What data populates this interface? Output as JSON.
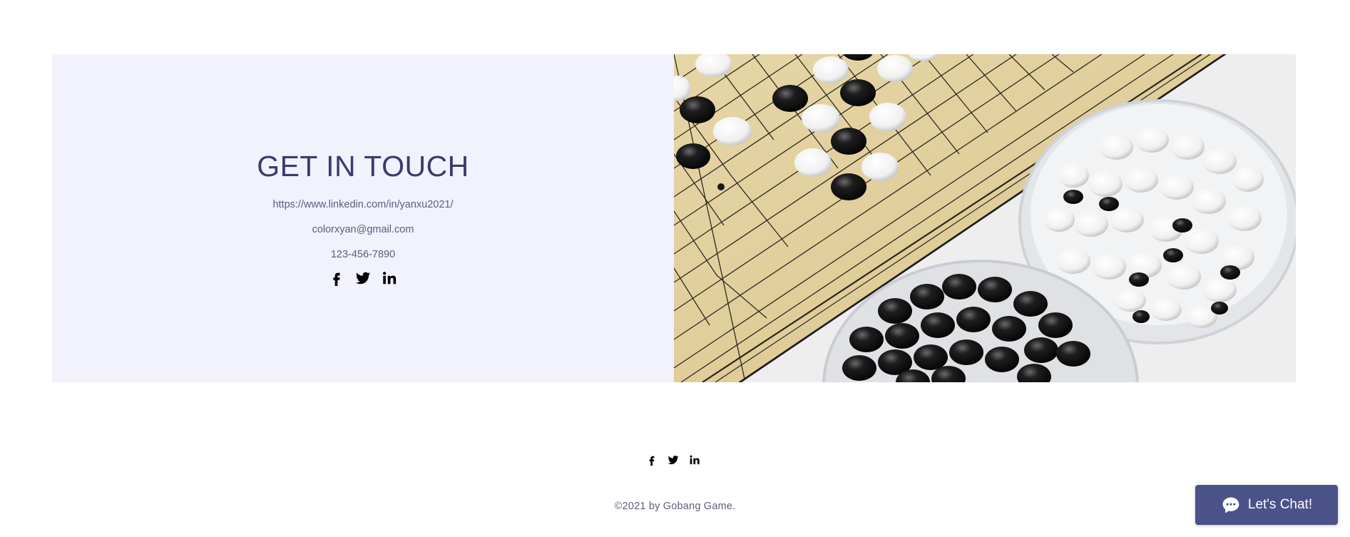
{
  "contact": {
    "title": "GET IN TOUCH",
    "linkedin_url": "https://www.linkedin.com/in/yanxu2021/",
    "email": "colorxyan@gmail.com",
    "phone": "123-456-7890",
    "social_icons": [
      "facebook-icon",
      "twitter-icon",
      "linkedin-icon"
    ]
  },
  "photo": {
    "subject": "go-board-with-stones-image"
  },
  "footer": {
    "social_icons": [
      "facebook-icon",
      "twitter-icon",
      "linkedin-icon"
    ],
    "copyright": "©2021 by Gobang Game."
  },
  "chat": {
    "label": "Let's Chat!",
    "icon": "chat-bubble-icon"
  },
  "colors": {
    "panel_background": "#f1f2fc",
    "title_color": "#3a3c6e",
    "text_color": "#5b5d80",
    "chat_background": "#4b5288"
  }
}
